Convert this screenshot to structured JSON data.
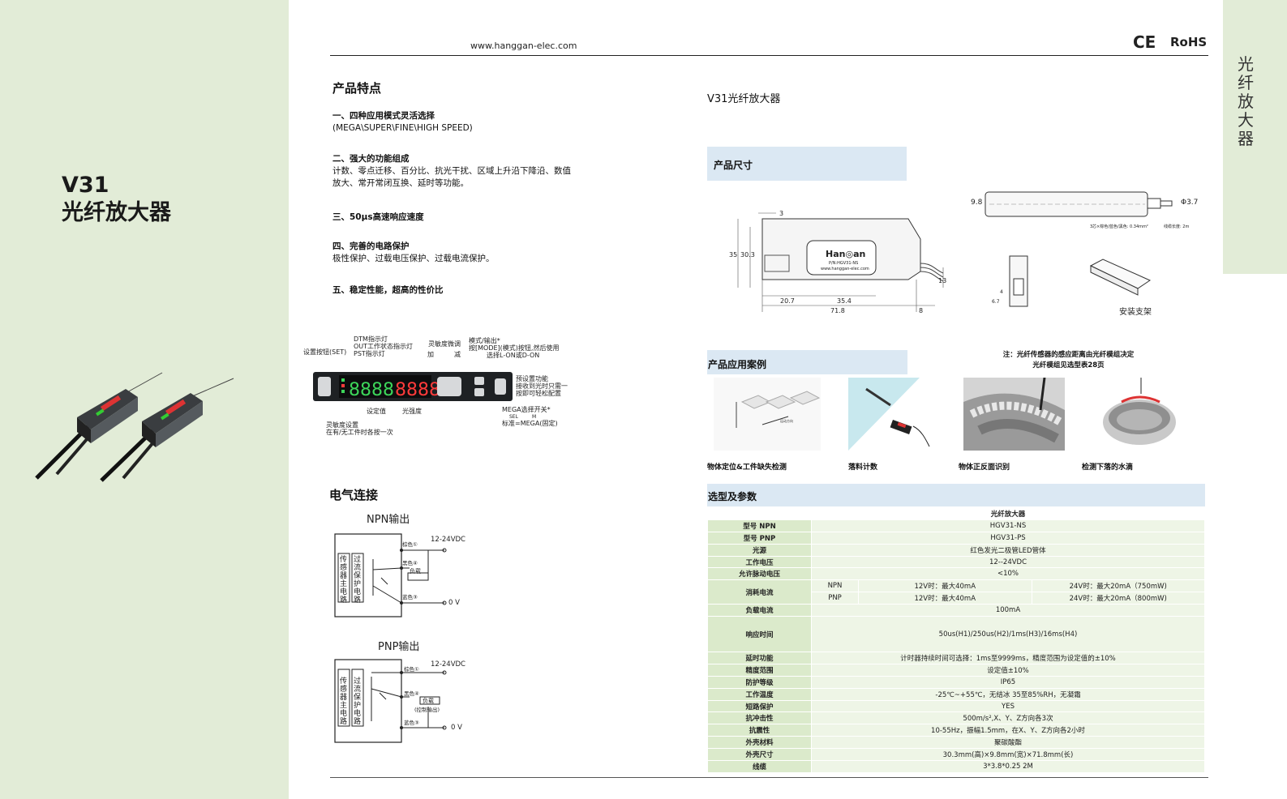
{
  "header": {
    "url": "www.hanggan-elec.com",
    "ce": "CE",
    "rohs": "RoHS"
  },
  "side_tab": "光纤放大器",
  "product": {
    "model": "V31",
    "name": "光纤放大器"
  },
  "features": {
    "title": "产品特点",
    "items": [
      {
        "heading": "一、四种应用模式灵活选择",
        "body": "(MEGA\\SUPER\\FINE\\HIGH SPEED)"
      },
      {
        "heading": "二、强大的功能组成",
        "body": "计数、零点迁移、百分比、抗光干扰、区域上升沿下降沿、数值",
        "body2": "放大、常开常闭互换、延时等功能。"
      },
      {
        "heading": "三、50μs高速响应速度",
        "body": ""
      },
      {
        "heading": "四、完善的电路保护",
        "body": "极性保护、过载电压保护、过载电流保护。"
      },
      {
        "heading": "五、稳定性能，超高的性价比",
        "body": ""
      }
    ]
  },
  "panel": {
    "labels": {
      "set_btn": "设置按钮(SET)",
      "dtm": "DTM指示灯",
      "out": "OUT工作状态指示灯",
      "pst": "PST指示灯",
      "sens": "灵敏度微调",
      "plus": "加",
      "minus": "减",
      "mode1": "模式/输出*",
      "mode2": "按[MODE](模式)按钮,然后使用",
      "mode3": "选择L-ON或D-ON",
      "preset1": "预设置功能",
      "preset2": "接收到光时只需一",
      "preset3": "按即可轻松配置",
      "mega1": "MEGA选择开关*",
      "mega_sel": "SEL",
      "mega_m": "M",
      "mega2": "标准=MEGA(固定)",
      "setval": "设定值",
      "light": "光强度",
      "sens_set1": "灵敏度设置",
      "sens_set2": "在有/无工件时各按一次",
      "digits_green": "8888",
      "digits_red": "8888"
    }
  },
  "electrical": {
    "title": "电气连接",
    "npn": {
      "title": "NPN输出",
      "voltage": "12-24VDC",
      "brown": "棕色①",
      "black": "黑色④",
      "blue": "蓝色③",
      "load": "负载",
      "zero": "0 V",
      "main": "传感器主电路",
      "prot": "过流保护电路"
    },
    "pnp": {
      "title": "PNP输出",
      "voltage": "12-24VDC",
      "brown": "棕色①",
      "black": "黑色④",
      "blue": "蓝色③",
      "load": "负载",
      "ctrl": "(控制输出)",
      "zero": "0 V",
      "main": "传感器主电路",
      "prot": "过流保护电路"
    }
  },
  "right": {
    "title": "V31光纤放大器",
    "dimensions": {
      "title": "产品尺寸",
      "d_3": "3",
      "d_35": "35",
      "d_303": "30.3",
      "d_207": "20.7",
      "d_354": "35.4",
      "d_718": "71.8",
      "d_8": "8",
      "d_13": "13",
      "brand": "Han",
      "brand2": "an",
      "part": "P/N:HGV31-NS",
      "web": "www.hanggan-elec.com",
      "cable_98": "9.8",
      "cable_phi": "Φ3.7",
      "cable_note1": "3芯×棕色/蓝色/黑色: 0.34mm²",
      "cable_note2": "线缆长度: 2m",
      "small_4": "4",
      "small_67": "6.7",
      "bracket": "安装支架"
    },
    "cases": {
      "title": "产品应用案例",
      "note1": "注：光纤传感器的感应距离由光纤模组决定",
      "note2": "光纤模组见选型表28页",
      "items": [
        "物体定位&工件缺失检测",
        "落料计数",
        "物体正反面识别",
        "检测下落的水滴"
      ],
      "arrow_label": "运动方向"
    },
    "selection": {
      "title": "选型及参数",
      "header": "光纤放大器",
      "rows": [
        {
          "k": "型号  NPN",
          "v": "HGV31-NS"
        },
        {
          "k": "型号  PNP",
          "v": "HGV31-PS"
        },
        {
          "k": "光源",
          "v": "红色发光二极管LED管体"
        },
        {
          "k": "工作电压",
          "v": "12--24VDC"
        },
        {
          "k": "允许脉动电压",
          "v": "<10%"
        }
      ],
      "consumption": {
        "k": "消耗电流",
        "npn": {
          "type": "NPN",
          "a": "12V时：最大40mA",
          "b": "24V时：最大20mA（750mW)"
        },
        "pnp": {
          "type": "PNP",
          "a": "12V时：最大40mA",
          "b": "24V时：最大20mA（800mW)"
        }
      },
      "load": {
        "k": "负载电流",
        "v": "100mA"
      },
      "response": {
        "k": "响应时间",
        "v": "50us(H1)/250us(H2)/1ms(H3)/16ms(H4)"
      },
      "rows2": [
        {
          "k": "延时功能",
          "v": "计时器持续时间可选择：1ms至9999ms，精度范围为设定值的±10%"
        },
        {
          "k": "精度范围",
          "v": "设定值±10%"
        },
        {
          "k": "防护等级",
          "v": "IP65"
        },
        {
          "k": "工作温度",
          "v": "-25℃~+55℃，无结冰     35至85%RH，无凝霜"
        },
        {
          "k": "短路保护",
          "v": "YES"
        },
        {
          "k": "抗冲击性",
          "v": "500m/s²,X、Y、Z方向各3次"
        },
        {
          "k": "抗震性",
          "v": "10-55Hz，振幅1.5mm，在X、Y、Z方向各2小时"
        },
        {
          "k": "外壳材料",
          "v": "聚碳酸酯"
        },
        {
          "k": "外壳尺寸",
          "v": "30.3mm(高)×9.8mm(宽)×71.8mm(长)"
        },
        {
          "k": "线缆",
          "v": "3*3.8*0.25  2M"
        }
      ]
    }
  },
  "colors": {
    "panel_green": "#e2ecd7",
    "band_blue": "#dbe8f3",
    "key_green": "#dbeacb",
    "value_green": "#eef5e6",
    "led_green": "#3dd65a",
    "led_red": "#ff3b3b"
  }
}
